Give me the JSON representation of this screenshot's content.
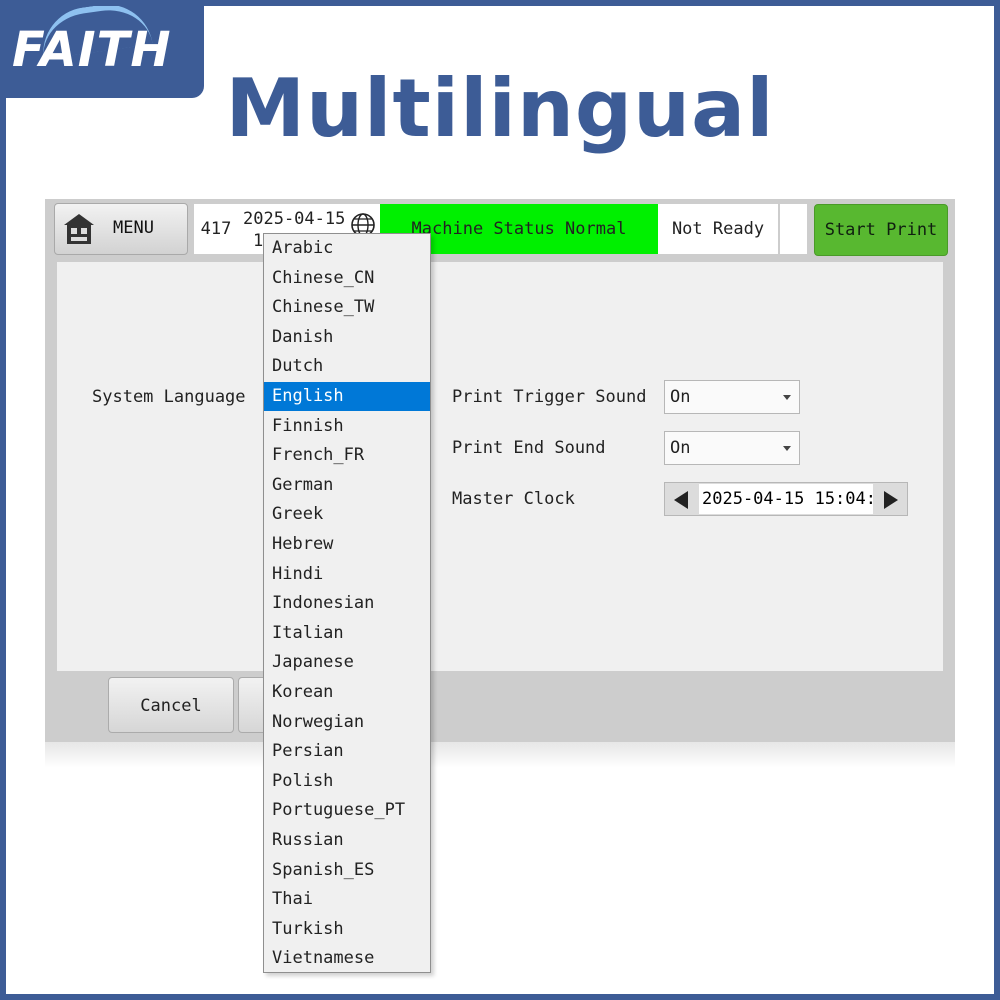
{
  "brand": {
    "logo_text": "FAITH"
  },
  "headline": "Multilingual",
  "topbar": {
    "menu_label": "MENU",
    "count": "417",
    "date_line1": "2025-04-15",
    "date_line2": "1",
    "machine_status": "Machine Status Normal",
    "ready_status": "Not Ready",
    "start_label": "Start Print"
  },
  "settings": {
    "system_language_label": "System Language",
    "print_trigger_sound_label": "Print Trigger Sound",
    "print_trigger_sound_value": "On",
    "print_end_sound_label": "Print End Sound",
    "print_end_sound_value": "On",
    "master_clock_label": "Master Clock",
    "master_clock_value": "2025-04-15 15:04:"
  },
  "footer": {
    "cancel_label": "Cancel"
  },
  "language_dropdown": {
    "selected": "English",
    "options": [
      "Arabic",
      "Chinese_CN",
      "Chinese_TW",
      "Danish",
      "Dutch",
      "English",
      "Finnish",
      "French_FR",
      "German",
      "Greek",
      "Hebrew",
      "Hindi",
      "Indonesian",
      "Italian",
      "Japanese",
      "Korean",
      "Norwegian",
      "Persian",
      "Polish",
      "Portuguese_PT",
      "Russian",
      "Spanish_ES",
      "Thai",
      "Turkish",
      "Vietnamese"
    ]
  },
  "colors": {
    "brand_blue": "#3d5c96",
    "status_green": "#00f000",
    "start_green": "#58b830",
    "selection_blue": "#0078d7"
  },
  "icons": [
    "home-icon",
    "globe-icon",
    "chevron-down-icon",
    "arrow-left-icon",
    "arrow-right-icon"
  ]
}
